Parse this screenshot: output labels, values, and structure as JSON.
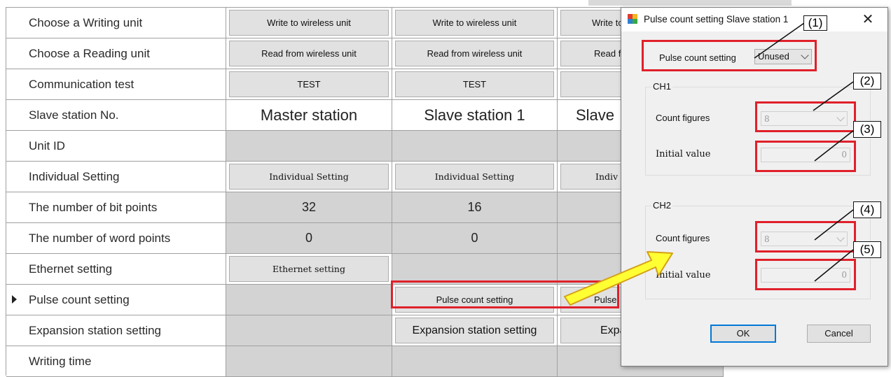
{
  "grid": {
    "rows": [
      {
        "label": "Choose a Writing unit",
        "kind": "buttons",
        "cells": [
          "Write to wireless unit",
          "Write to wireless unit",
          "Write to"
        ]
      },
      {
        "label": "Choose a Reading unit",
        "kind": "buttons",
        "cells": [
          "Read from wireless unit",
          "Read from wireless unit",
          "Read fro"
        ]
      },
      {
        "label": "Communication test",
        "kind": "buttons",
        "cells": [
          "TEST",
          "TEST",
          ""
        ]
      },
      {
        "label": "Slave station No.",
        "kind": "text",
        "cells": [
          "Master station",
          "Slave station 1",
          "Slave"
        ]
      },
      {
        "label": "Unit ID",
        "kind": "empty",
        "cells": [
          "",
          "",
          ""
        ]
      },
      {
        "label": "Individual Setting",
        "kind": "buttons",
        "cells": [
          "Individual Setting",
          "Individual Setting",
          "Indiv"
        ]
      },
      {
        "label": "The number of bit points",
        "kind": "number",
        "cells": [
          "32",
          "16",
          ""
        ]
      },
      {
        "label": "The number of word points",
        "kind": "number",
        "cells": [
          "0",
          "0",
          ""
        ]
      },
      {
        "label": "Ethernet setting",
        "kind": "mixed",
        "cells": [
          "Ethernet setting",
          "",
          ""
        ]
      },
      {
        "label": "Pulse count setting",
        "kind": "mixed",
        "cells": [
          "",
          "Pulse count setting",
          "Pulse"
        ]
      },
      {
        "label": "Expansion station setting",
        "kind": "mixed",
        "cells": [
          "",
          "Expansion station setting",
          "Expansion"
        ]
      },
      {
        "label": "Writing time",
        "kind": "empty",
        "cells": [
          "",
          "",
          ""
        ]
      }
    ]
  },
  "dialog": {
    "title": "Pulse count setting Slave station 1",
    "close_glyph": "✕",
    "pulse_label": "Pulse count setting",
    "pulse_value": "Unused",
    "ch1": {
      "group": "CH1",
      "count_label": "Count figures",
      "count_value": "8",
      "init_label": "Initial value",
      "init_value": "0"
    },
    "ch2": {
      "group": "CH2",
      "count_label": "Count figures",
      "count_value": "8",
      "init_label": "Initial value",
      "init_value": "0"
    },
    "ok": "OK",
    "cancel": "Cancel"
  },
  "callouts": [
    "(1)",
    "(2)",
    "(3)",
    "(4)",
    "(5)"
  ],
  "colors": {
    "highlight": "#e0202a",
    "arrow_fill": "#ffff33",
    "arrow_stroke": "#d4a017"
  }
}
